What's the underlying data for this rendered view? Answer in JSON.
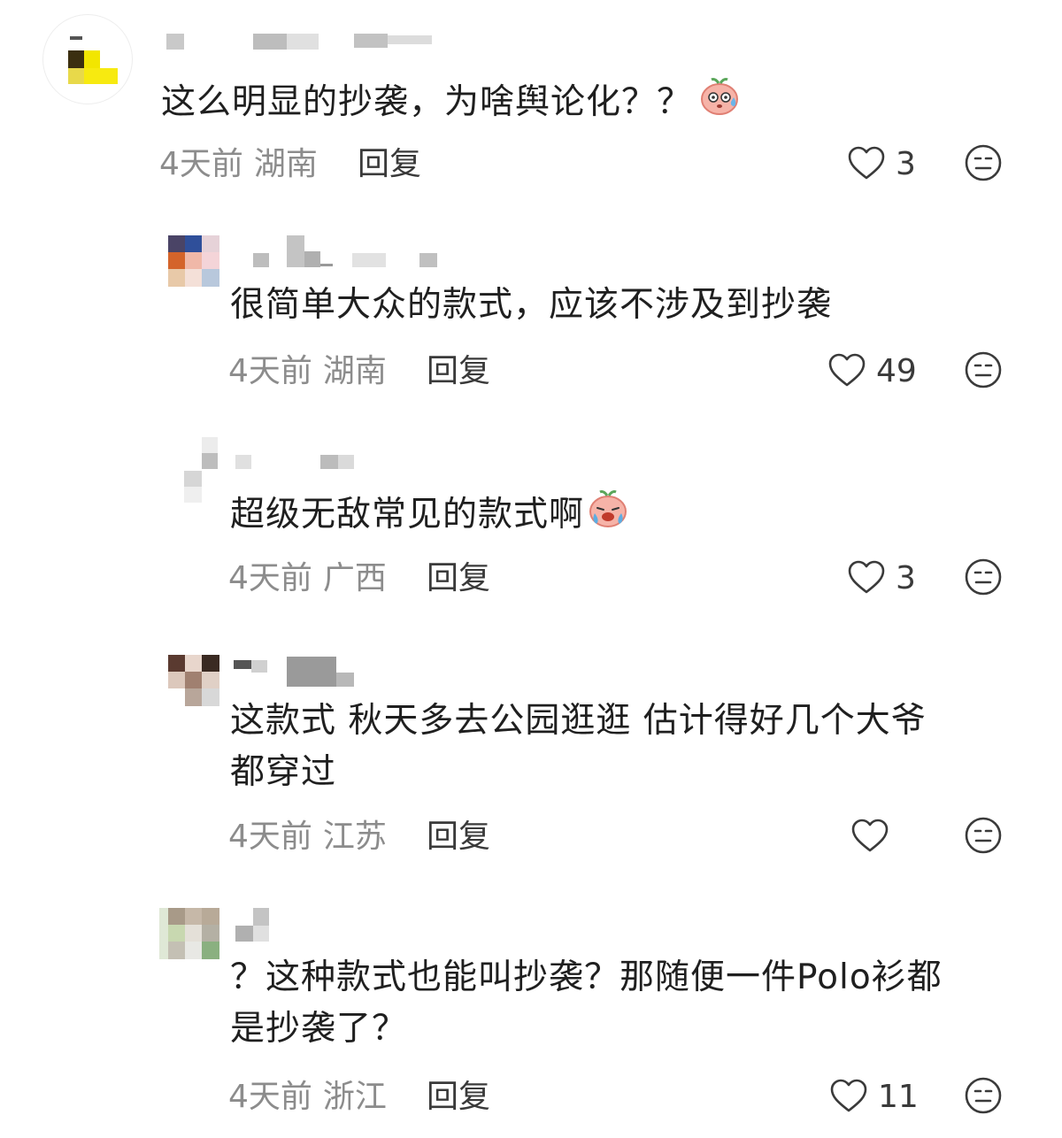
{
  "comments": [
    {
      "text": "这么明显的抄袭，为啥舆论化？？",
      "emoji": "sweat-peach-emoji",
      "time": "4天前",
      "location": "湖南",
      "reply_label": "回复",
      "likes": "3"
    },
    {
      "text": "很简单大众的款式，应该不涉及到抄袭",
      "time": "4天前",
      "location": "湖南",
      "reply_label": "回复",
      "likes": "49"
    },
    {
      "text": "超级无敌常见的款式啊",
      "emoji": "crying-peach-emoji",
      "time": "4天前",
      "location": "广西",
      "reply_label": "回复",
      "likes": "3"
    },
    {
      "text_lines": [
        "这款式 秋天多去公园逛逛 估计得好几个大爷",
        "都穿过"
      ],
      "time": "4天前",
      "location": "江苏",
      "reply_label": "回复",
      "likes": ""
    },
    {
      "text_lines": [
        "？这种款式也能叫抄袭？那随便一件Polo衫都",
        "是抄袭了？"
      ],
      "time": "4天前",
      "location": "浙江",
      "reply_label": "回复",
      "likes": "11"
    }
  ],
  "icons": {
    "like": "heart-outline-icon",
    "dislike": "neutral-face-icon"
  },
  "colors": {
    "text": "#1f1f1f",
    "meta": "#8c8c8c",
    "icon": "#3a3a3a"
  }
}
